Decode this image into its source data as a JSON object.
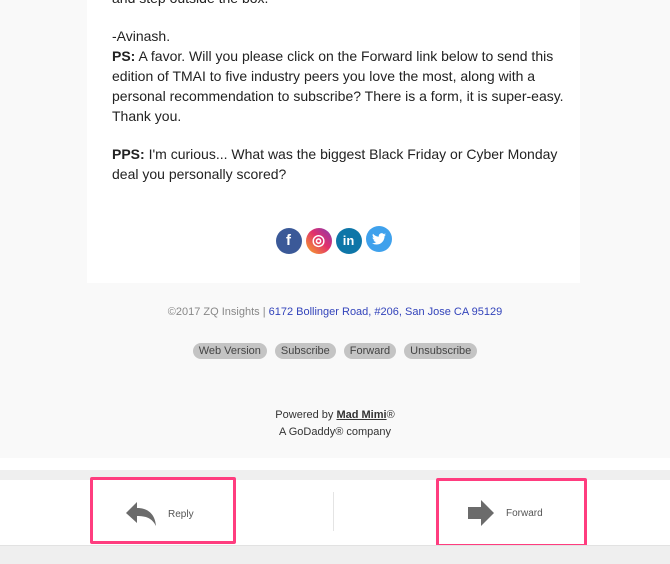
{
  "email": {
    "cut_line": "and step outside the box.",
    "signature": "-Avinash.",
    "ps_label": "PS:",
    "ps_text": " A favor. Will you please click on the Forward link below to send this edition of TMAI to five industry peers you love the most, along with a personal recommendation to subscribe? There is a form, it is super-easy. Thank you.",
    "pps_label": "PPS:",
    "pps_text": " I'm curious... What was the biggest Black Friday or Cyber Monday deal you personally scored?",
    "social": [
      {
        "icon": "facebook-icon",
        "glyph": "f"
      },
      {
        "icon": "instagram-icon",
        "glyph": "◎"
      },
      {
        "icon": "linkedin-icon",
        "glyph": "in"
      },
      {
        "icon": "twitter-icon",
        "glyph": "🐦"
      }
    ]
  },
  "footer": {
    "copyright": "©2017 ZQ Insights | ",
    "address": "6172 Bollinger Road, #206, San Jose CA 95129",
    "links": [
      "Web Version",
      "Subscribe",
      "Forward",
      "Unsubscribe"
    ],
    "powered_by": "Powered by ",
    "brand": "Mad Mimi",
    "reg": "®",
    "company": "A GoDaddy® company"
  },
  "actions": {
    "reply_label": "Reply",
    "forward_label": "Forward",
    "highlight_color": "#ff3d7f"
  }
}
